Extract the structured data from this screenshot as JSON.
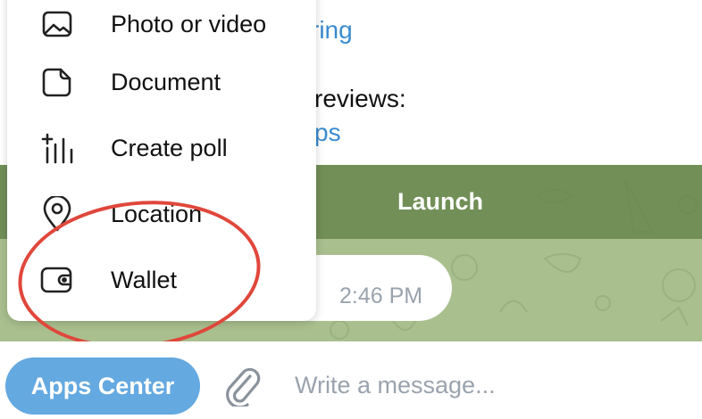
{
  "chat": {
    "message_link_top": "ring",
    "message_text_mid": "reviews:",
    "message_link_mid": "ps",
    "launch_label": "Launch",
    "time": "2:46 PM"
  },
  "attach_menu": {
    "items": [
      {
        "label": "Photo or video",
        "icon": "photo-icon"
      },
      {
        "label": "Document",
        "icon": "document-icon"
      },
      {
        "label": "Create poll",
        "icon": "poll-icon"
      },
      {
        "label": "Location",
        "icon": "location-pin-icon"
      },
      {
        "label": "Wallet",
        "icon": "wallet-icon"
      }
    ]
  },
  "input_bar": {
    "apps_label": "Apps Center",
    "placeholder": "Write a message..."
  },
  "colors": {
    "accent": "#64a9e0",
    "link": "#3a8bd0",
    "annotation": "#e0473b",
    "wallpaper": "#a9bf8e"
  }
}
